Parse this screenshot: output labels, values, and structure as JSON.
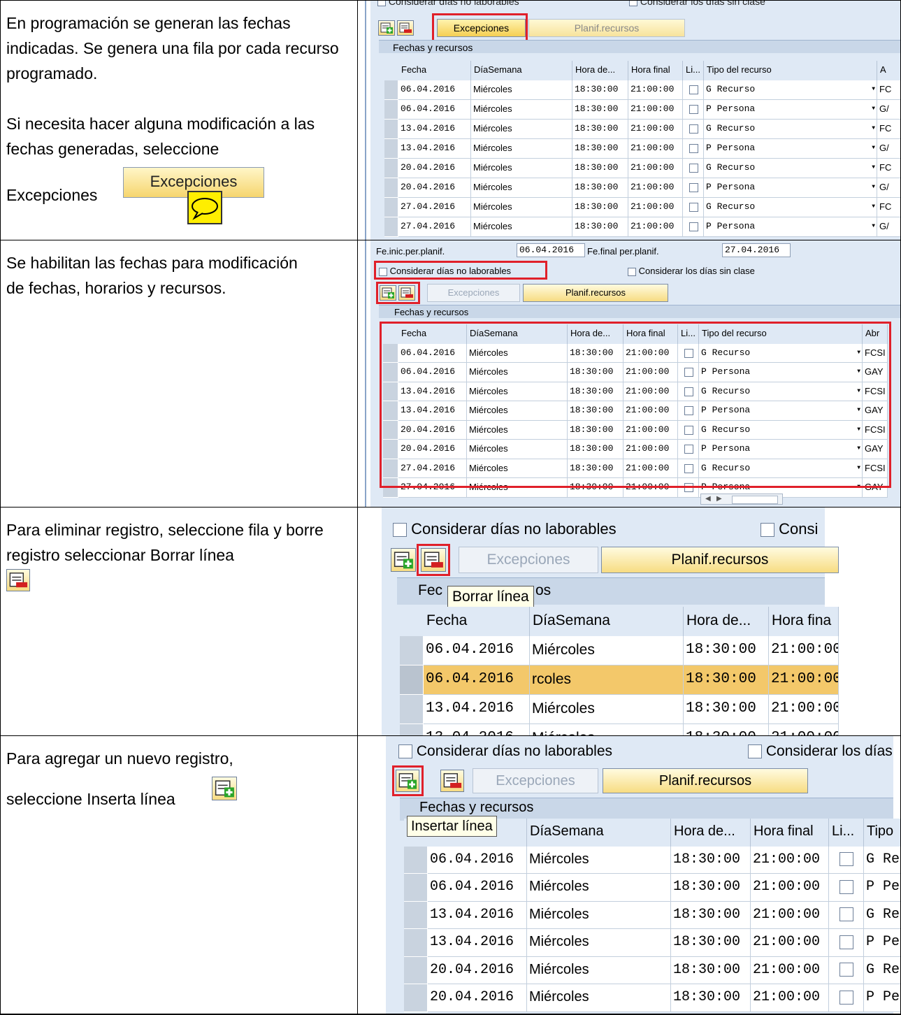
{
  "rows": [
    {
      "text1": "En programación se generan las fechas indicadas. Se genera una fila por cada recurso programado.",
      "text2": "Si necesita hacer alguna modificación a las fechas generadas, seleccione",
      "text3": "Excepciones",
      "inline_button": "Excepciones"
    },
    {
      "text1": "Se habilitan las fechas para modificación de fechas, horarios y recursos."
    },
    {
      "text1": "Para eliminar registro, seleccione fila y borre registro seleccionar Borrar línea"
    },
    {
      "text1": "Para agregar un nuevo registro,",
      "text2": "seleccione Inserta línea"
    }
  ],
  "sap": {
    "chk_nonworking": "Considerar días no laborables",
    "chk_nonworking_clip": "Considerar días no laborables",
    "chk_noclass": "Considerar los días sin clase",
    "chk_noclass_short": "Consi",
    "chk_noclass_clip": "Considerar los días",
    "btn_exceptions": "Excepciones",
    "btn_resources": "Planif.recursos",
    "section_title": "Fechas y recursos",
    "section_title_clip": "Fec",
    "section_title_tail": "os",
    "start_label": "Fe.inic.per.planif.",
    "start_value": "06.04.2016",
    "end_label": "Fe.final per.planif.",
    "end_value": "27.04.2016",
    "tooltip_delete": "Borrar línea",
    "tooltip_insert": "Insertar línea",
    "columns": [
      "Fecha",
      "DíaSemana",
      "Hora de...",
      "Hora final",
      "Li...",
      "Tipo del recurso",
      "A"
    ],
    "columns_clip": {
      "tipo_short": "Tipo",
      "hora_final_clip": "Hora fina",
      "col_abr": "Abr"
    },
    "grid_rows": [
      {
        "fecha": "06.04.2016",
        "dia": "Miércoles",
        "hini": "18:30:00",
        "hfin": "21:00:00",
        "tipo": "G Recurso",
        "tipo_clip": "G Re",
        "abr": "FC",
        "abr2": "FCSI"
      },
      {
        "fecha": "06.04.2016",
        "dia": "Miércoles",
        "hini": "18:30:00",
        "hfin": "21:00:00",
        "tipo": "P Persona",
        "tipo_clip": "P Pe",
        "abr": "G/",
        "abr2": "GAY"
      },
      {
        "fecha": "13.04.2016",
        "dia": "Miércoles",
        "hini": "18:30:00",
        "hfin": "21:00:00",
        "tipo": "G Recurso",
        "tipo_clip": "G Re",
        "abr": "FC",
        "abr2": "FCSI"
      },
      {
        "fecha": "13.04.2016",
        "dia": "Miércoles",
        "hini": "18:30:00",
        "hfin": "21:00:00",
        "tipo": "P Persona",
        "tipo_clip": "P Pe",
        "abr": "G/",
        "abr2": "GAY"
      },
      {
        "fecha": "20.04.2016",
        "dia": "Miércoles",
        "hini": "18:30:00",
        "hfin": "21:00:00",
        "tipo": "G Recurso",
        "tipo_clip": "G Re",
        "abr": "FC",
        "abr2": "FCSI"
      },
      {
        "fecha": "20.04.2016",
        "dia": "Miércoles",
        "hini": "18:30:00",
        "hfin": "21:00:00",
        "tipo": "P Persona",
        "tipo_clip": "P Pe",
        "abr": "G/",
        "abr2": "GAY"
      },
      {
        "fecha": "27.04.2016",
        "dia": "Miércoles",
        "hini": "18:30:00",
        "hfin": "21:00:00",
        "tipo": "G Recurso",
        "tipo_clip": "G Re",
        "abr": "FC",
        "abr2": "FCSI"
      },
      {
        "fecha": "27.04.2016",
        "dia": "Miércoles",
        "hini": "18:30:00",
        "hfin": "21:00:00",
        "tipo": "P Persona",
        "tipo_clip": "P Pe",
        "abr": "G/",
        "abr2": "GAY"
      }
    ],
    "row3_selected_dia": "rcoles",
    "row3_hfin_clip": "21:00:C"
  },
  "colors": {
    "highlight": "#e0202a",
    "sap_bg": "#dfe9f5",
    "button_yellow": "#f7dc82",
    "selected_row": "#f3c86a"
  }
}
